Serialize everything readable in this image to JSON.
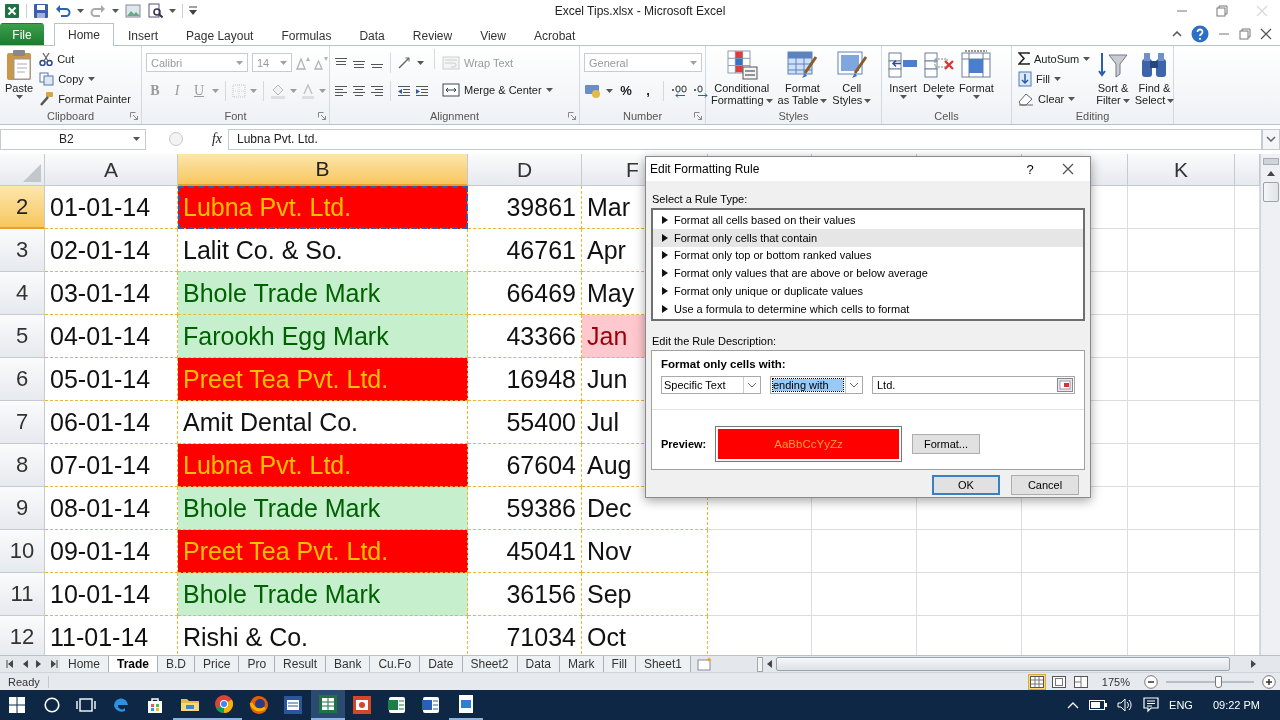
{
  "title_bar": {
    "title": "Excel Tips.xlsx - Microsoft Excel"
  },
  "ribbon_tabs": [
    {
      "label": "File",
      "kind": "file",
      "selected": false
    },
    {
      "label": "Home",
      "kind": "tab",
      "selected": true
    },
    {
      "label": "Insert",
      "kind": "tab",
      "selected": false
    },
    {
      "label": "Page Layout",
      "kind": "tab",
      "selected": false
    },
    {
      "label": "Formulas",
      "kind": "tab",
      "selected": false
    },
    {
      "label": "Data",
      "kind": "tab",
      "selected": false
    },
    {
      "label": "Review",
      "kind": "tab",
      "selected": false
    },
    {
      "label": "View",
      "kind": "tab",
      "selected": false
    },
    {
      "label": "Acrobat",
      "kind": "tab",
      "selected": false
    }
  ],
  "ribbon_groups": [
    {
      "kind": "clipboard",
      "label": "Clipboard",
      "paste": "Paste",
      "commands": [
        {
          "label": "Cut",
          "dropdown": false
        },
        {
          "label": "Copy",
          "dropdown": true
        },
        {
          "label": "Format Painter",
          "dropdown": false
        }
      ]
    },
    {
      "kind": "font",
      "label": "Font",
      "disabled": true,
      "font_name": "Calibri",
      "font_size": "14",
      "styles": [
        "B",
        "I",
        "U"
      ]
    },
    {
      "kind": "alignment",
      "label": "Alignment",
      "commands": [
        {
          "label": "Wrap Text",
          "disabled": true
        },
        {
          "label": "Merge & Center",
          "disabled": false
        }
      ]
    },
    {
      "kind": "number",
      "label": "Number",
      "format": "General",
      "disabled": true,
      "symbols": [
        "%",
        ","
      ]
    },
    {
      "kind": "styles",
      "label": "Styles",
      "buttons": [
        "Conditional\nFormatting",
        "Format\nas Table",
        "Cell\nStyles"
      ]
    },
    {
      "kind": "cells",
      "label": "Cells",
      "buttons": [
        "Insert",
        "Delete",
        "Format"
      ]
    },
    {
      "kind": "editing",
      "label": "Editing",
      "commands": [
        "AutoSum",
        "Fill",
        "Clear"
      ],
      "buttons": [
        "Sort &\nFilter",
        "Find &\nSelect"
      ]
    }
  ],
  "formula_bar": {
    "name_box": "B2",
    "function_label": "fx",
    "value": "Lubna Pvt. Ltd."
  },
  "sheet": {
    "columns": [
      "A",
      "B",
      "D",
      "F",
      "K"
    ],
    "rows": [
      {
        "number": "2",
        "cells": [
          {
            "text": "01-01-14",
            "selected": false
          },
          {
            "text": "Lubna Pvt. Ltd.",
            "color": "#ff0000",
            "selected": true
          },
          {
            "text": "39861",
            "selected": false
          },
          {
            "text": "Mar",
            "selected": false
          }
        ]
      },
      {
        "number": "3",
        "cells": [
          {
            "text": "02-01-14",
            "selected": false
          },
          {
            "text": "Lalit Co. & So.",
            "selected": false
          },
          {
            "text": "46761",
            "selected": false
          },
          {
            "text": "Apr",
            "selected": false
          }
        ]
      },
      {
        "number": "4",
        "cells": [
          {
            "text": "03-01-14",
            "selected": false
          },
          {
            "text": "Bhole Trade Mark",
            "color": "#c6efce",
            "selected": false
          },
          {
            "text": "66469",
            "selected": false
          },
          {
            "text": "May",
            "selected": false
          }
        ]
      },
      {
        "number": "5",
        "cells": [
          {
            "text": "04-01-14",
            "selected": false
          },
          {
            "text": "Farookh Egg Mark",
            "color": "#c6efce",
            "selected": false
          },
          {
            "text": "43366",
            "selected": false
          },
          {
            "text": "Jan",
            "color": "#ffc7ce",
            "selected": false
          }
        ]
      },
      {
        "number": "6",
        "cells": [
          {
            "text": "05-01-14",
            "selected": false
          },
          {
            "text": "Preet Tea Pvt. Ltd.",
            "color": "#ff0000",
            "selected": false
          },
          {
            "text": "16948",
            "selected": false
          },
          {
            "text": "Jun",
            "selected": false
          }
        ]
      },
      {
        "number": "7",
        "cells": [
          {
            "text": "06-01-14",
            "selected": false
          },
          {
            "text": "Amit Dental Co.",
            "selected": false
          },
          {
            "text": "55400",
            "selected": false
          },
          {
            "text": "Jul",
            "selected": false
          }
        ]
      },
      {
        "number": "8",
        "cells": [
          {
            "text": "07-01-14",
            "selected": false
          },
          {
            "text": "Lubna Pvt. Ltd.",
            "color": "#ff0000",
            "selected": false
          },
          {
            "text": "67604",
            "selected": false
          },
          {
            "text": "Aug",
            "selected": false
          }
        ]
      },
      {
        "number": "9",
        "cells": [
          {
            "text": "08-01-14",
            "selected": false
          },
          {
            "text": "Bhole Trade Mark",
            "color": "#c6efce",
            "selected": false
          },
          {
            "text": "59386",
            "selected": false
          },
          {
            "text": "Dec",
            "selected": false
          }
        ]
      },
      {
        "number": "10",
        "cells": [
          {
            "text": "09-01-14",
            "selected": false
          },
          {
            "text": "Preet Tea Pvt. Ltd.",
            "color": "#ff0000",
            "selected": false
          },
          {
            "text": "45041",
            "selected": false
          },
          {
            "text": "Nov",
            "selected": false
          }
        ]
      },
      {
        "number": "11",
        "cells": [
          {
            "text": "10-01-14",
            "selected": false
          },
          {
            "text": "Bhole Trade Mark",
            "color": "#c6efce",
            "selected": false
          },
          {
            "text": "36156",
            "selected": false
          },
          {
            "text": "Sep",
            "selected": false
          }
        ]
      },
      {
        "number": "12",
        "cells": [
          {
            "text": "11-01-14",
            "selected": false
          },
          {
            "text": "Rishi & Co.",
            "selected": false
          },
          {
            "text": "71034",
            "selected": false
          },
          {
            "text": "Oct",
            "selected": false
          }
        ]
      }
    ]
  },
  "dialog": {
    "title": "Edit Formatting Rule",
    "help": "?",
    "rule_type_label": "Select a Rule Type:",
    "rule_types": [
      {
        "label": "Format all cells based on their values",
        "selected": false
      },
      {
        "label": "Format only cells that contain",
        "selected": true
      },
      {
        "label": "Format only top or bottom ranked values",
        "selected": false
      },
      {
        "label": "Format only values that are above or below average",
        "selected": false
      },
      {
        "label": "Format only unique or duplicate values",
        "selected": false
      },
      {
        "label": "Use a formula to determine which cells to format",
        "selected": false
      }
    ],
    "description_label": "Edit the Rule Description:",
    "condition_label": "Format only cells with:",
    "conditions": [
      {
        "kind": "dropdown",
        "value": "Specific Text",
        "focused": false
      },
      {
        "kind": "dropdown",
        "value": "ending with",
        "focused": true
      },
      {
        "kind": "reference",
        "value": "Ltd.",
        "focused": false
      }
    ],
    "preview_label": "Preview:",
    "preview_sample": "AaBbCcYyZz",
    "format_button": "Format...",
    "buttons": [
      {
        "label": "OK",
        "default": true
      },
      {
        "label": "Cancel",
        "default": false
      }
    ]
  },
  "sheet_tabs": [
    {
      "label": "Home",
      "selected": false
    },
    {
      "label": "Trade",
      "selected": true
    },
    {
      "label": "B.D",
      "selected": false
    },
    {
      "label": "Price",
      "selected": false
    },
    {
      "label": "Pro",
      "selected": false
    },
    {
      "label": "Result",
      "selected": false
    },
    {
      "label": "Bank",
      "selected": false
    },
    {
      "label": "Cu.Fo",
      "selected": false
    },
    {
      "label": "Date",
      "selected": false
    },
    {
      "label": "Sheet2",
      "selected": false
    },
    {
      "label": "Data",
      "selected": false
    },
    {
      "label": "Mark",
      "selected": false
    },
    {
      "label": "Fill",
      "selected": false
    },
    {
      "label": "Sheet1",
      "selected": false
    }
  ],
  "status_bar": {
    "status": "Ready",
    "views": [
      {
        "kind": "normal",
        "selected": true
      },
      {
        "kind": "page_layout",
        "selected": false
      },
      {
        "kind": "page_break",
        "selected": false
      }
    ],
    "zoom": "175%",
    "zoom_slider": {
      "level": 0.6
    }
  },
  "taskbar": {
    "apps": [
      {
        "kind": "edge",
        "running": false,
        "active": false
      },
      {
        "kind": "store",
        "running": false,
        "active": false
      },
      {
        "kind": "explorer",
        "running": true,
        "active": false
      },
      {
        "kind": "chrome",
        "running": true,
        "active": false
      },
      {
        "kind": "firefox",
        "running": false,
        "active": false
      },
      {
        "kind": "word",
        "running": false,
        "active": false
      },
      {
        "kind": "excel",
        "running": true,
        "active": true
      },
      {
        "kind": "powerpoint",
        "running": false,
        "active": false
      },
      {
        "kind": "excel_alt",
        "running": false,
        "active": false
      },
      {
        "kind": "word_alt",
        "running": false,
        "active": false
      },
      {
        "kind": "notepad",
        "running": true,
        "active": false
      }
    ],
    "language": "ENG",
    "time": "09:22 PM"
  }
}
